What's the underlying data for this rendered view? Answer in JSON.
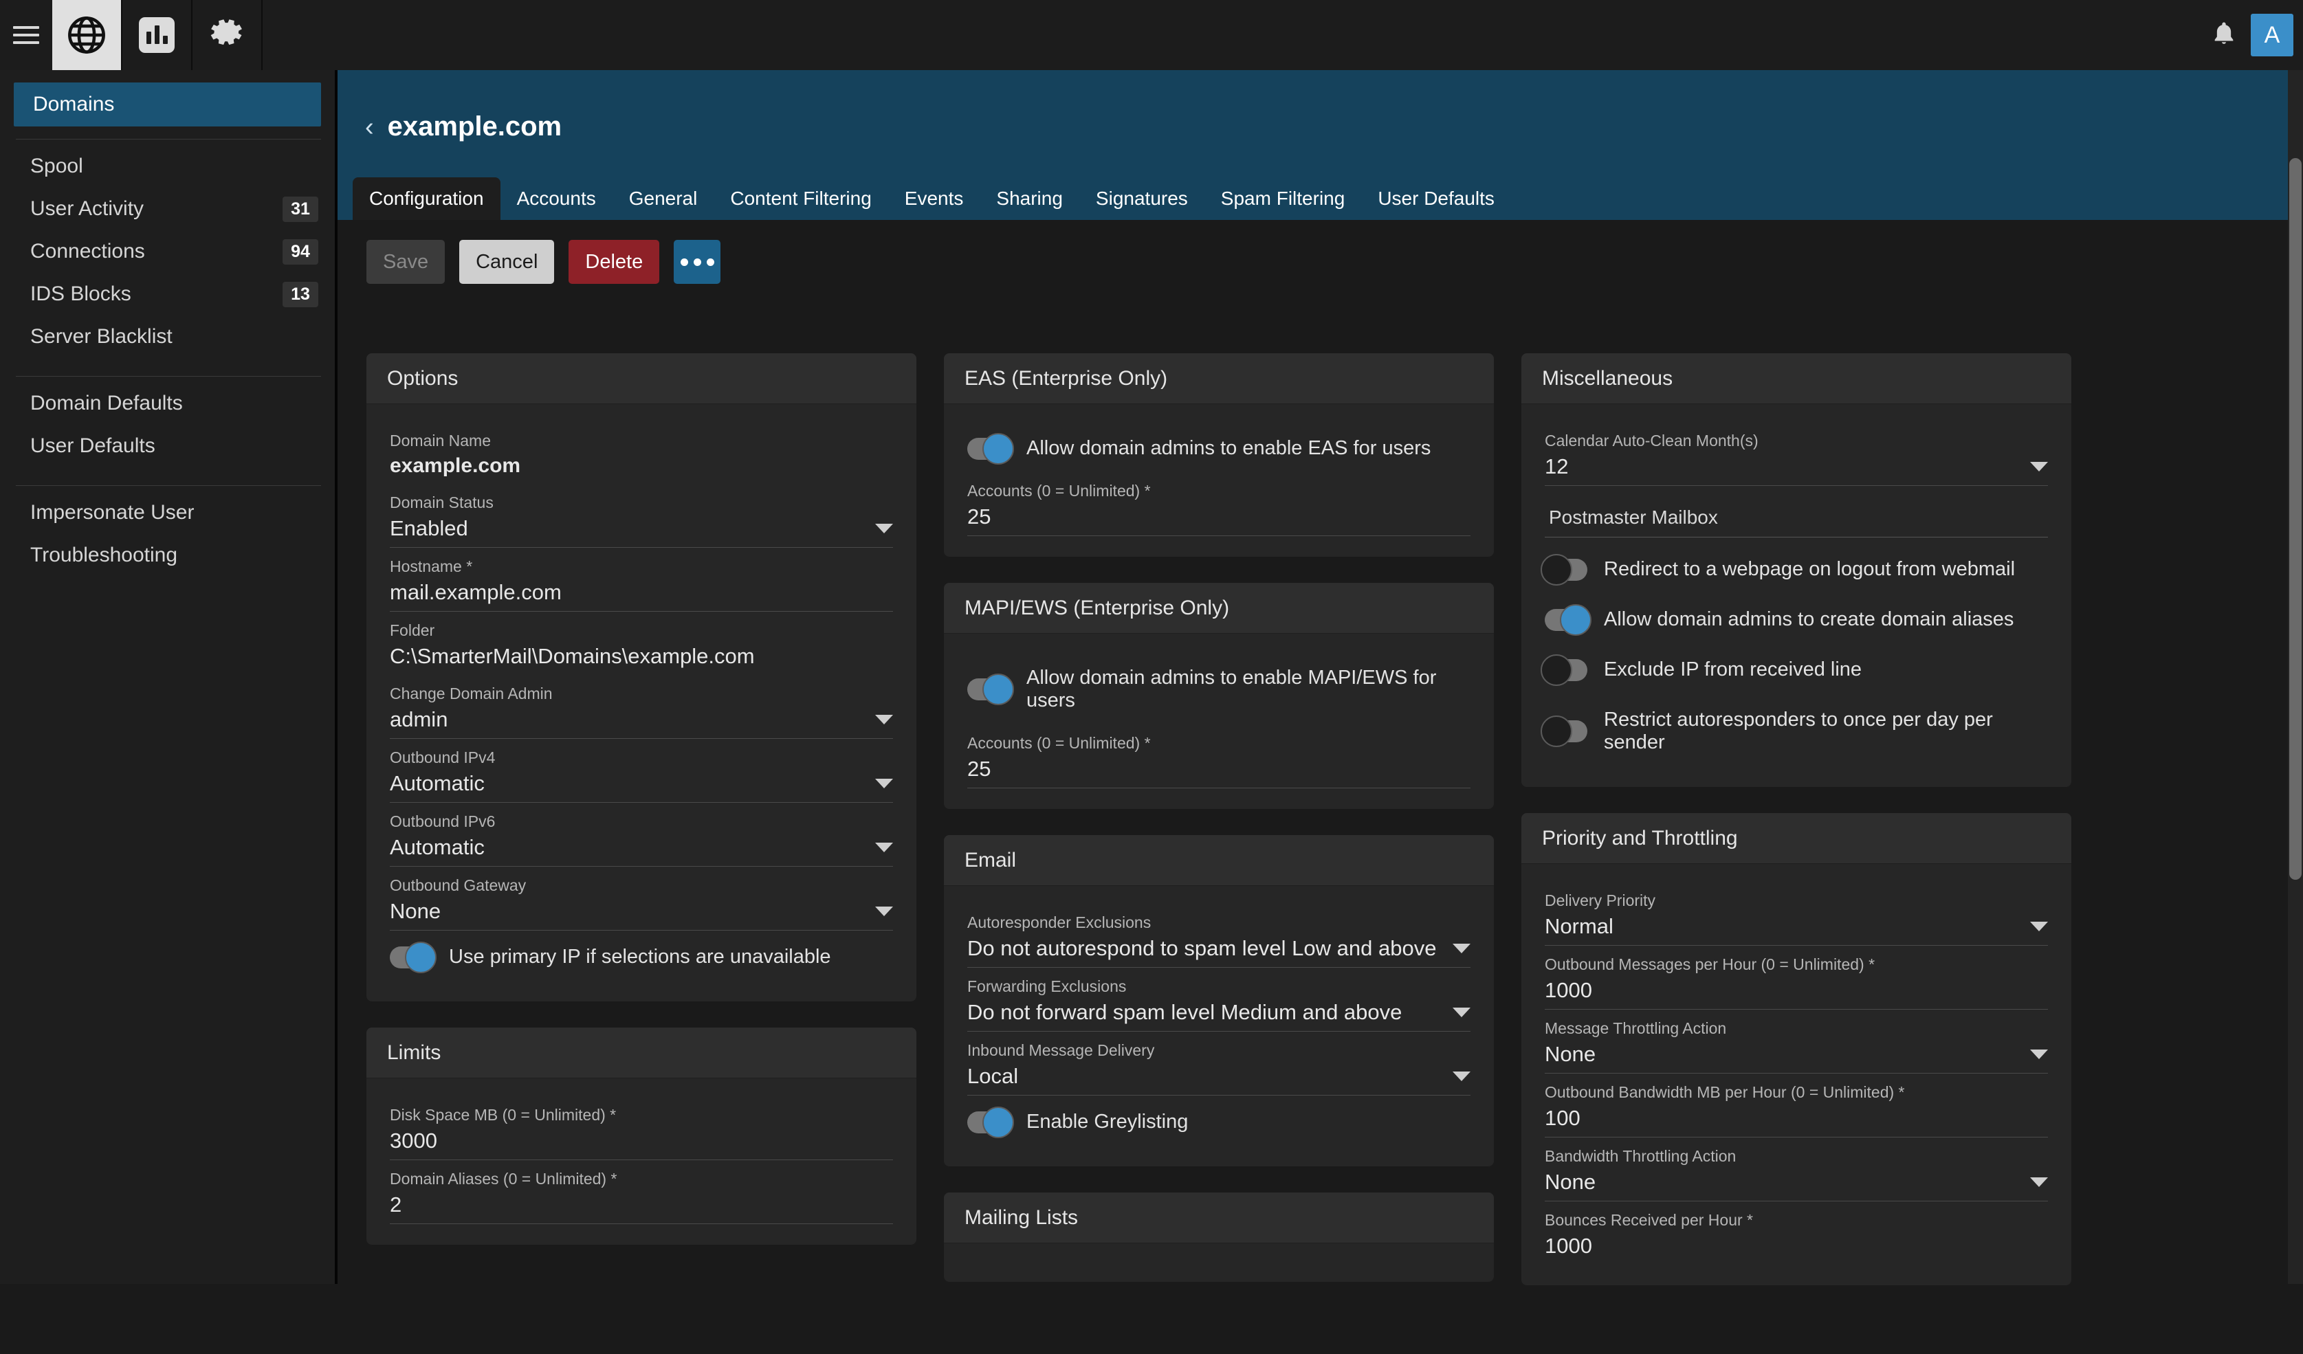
{
  "topbar": {
    "menu_icon": "hamburger-icon",
    "nav": [
      {
        "icon": "globe-icon",
        "active": true
      },
      {
        "icon": "bar-chart-icon",
        "active": false
      },
      {
        "icon": "gear-icon",
        "active": false
      }
    ],
    "bell_icon": "bell-icon",
    "avatar_initial": "A"
  },
  "sidebar": {
    "active_item": "Domains",
    "groups": [
      {
        "items": [
          {
            "label": "Spool",
            "badge": ""
          },
          {
            "label": "User Activity",
            "badge": "31"
          },
          {
            "label": "Connections",
            "badge": "94"
          },
          {
            "label": "IDS Blocks",
            "badge": "13"
          },
          {
            "label": "Server Blacklist",
            "badge": ""
          }
        ]
      },
      {
        "items": [
          {
            "label": "Domain Defaults",
            "badge": ""
          },
          {
            "label": "User Defaults",
            "badge": ""
          }
        ]
      },
      {
        "items": [
          {
            "label": "Impersonate User",
            "badge": ""
          },
          {
            "label": "Troubleshooting",
            "badge": ""
          }
        ]
      }
    ]
  },
  "header": {
    "back_chevron": "‹",
    "title": "example.com"
  },
  "tabs": [
    {
      "label": "Configuration",
      "active": true
    },
    {
      "label": "Accounts",
      "active": false
    },
    {
      "label": "General",
      "active": false
    },
    {
      "label": "Content Filtering",
      "active": false
    },
    {
      "label": "Events",
      "active": false
    },
    {
      "label": "Sharing",
      "active": false
    },
    {
      "label": "Signatures",
      "active": false
    },
    {
      "label": "Spam Filtering",
      "active": false
    },
    {
      "label": "User Defaults",
      "active": false
    }
  ],
  "toolbar": {
    "save_label": "Save",
    "cancel_label": "Cancel",
    "delete_label": "Delete",
    "more_label": ""
  },
  "options": {
    "title": "Options",
    "domain_name_label": "Domain Name",
    "domain_name_value": "example.com",
    "domain_status_label": "Domain Status",
    "domain_status_value": "Enabled",
    "hostname_label": "Hostname *",
    "hostname_value": "mail.example.com",
    "folder_label": "Folder",
    "folder_value": "C:\\SmarterMail\\Domains\\example.com",
    "change_admin_label": "Change Domain Admin",
    "change_admin_value": "admin",
    "ipv4_label": "Outbound IPv4",
    "ipv4_value": "Automatic",
    "ipv6_label": "Outbound IPv6",
    "ipv6_value": "Automatic",
    "gateway_label": "Outbound Gateway",
    "gateway_value": "None",
    "primary_ip_toggle_label": "Use primary IP if selections are unavailable"
  },
  "limits": {
    "title": "Limits",
    "disk_space_label": "Disk Space MB (0 = Unlimited) *",
    "disk_space_value": "3000",
    "domain_aliases_label": "Domain Aliases (0 = Unlimited) *",
    "domain_aliases_value": "2"
  },
  "eas": {
    "title": "EAS (Enterprise Only)",
    "toggle_label": "Allow domain admins to enable EAS for users",
    "accounts_label": "Accounts (0 = Unlimited) *",
    "accounts_value": "25"
  },
  "mapi": {
    "title": "MAPI/EWS (Enterprise Only)",
    "toggle_label": "Allow domain admins to enable MAPI/EWS for users",
    "accounts_label": "Accounts (0 = Unlimited) *",
    "accounts_value": "25"
  },
  "email": {
    "title": "Email",
    "autoresponder_label": "Autoresponder Exclusions",
    "autoresponder_value": "Do not autorespond to spam level Low and above",
    "forwarding_label": "Forwarding Exclusions",
    "forwarding_value": "Do not forward spam level Medium and above",
    "inbound_label": "Inbound Message Delivery",
    "inbound_value": "Local",
    "greylisting_label": "Enable Greylisting"
  },
  "mailing_lists": {
    "title": "Mailing Lists"
  },
  "misc": {
    "title": "Miscellaneous",
    "calendar_label": "Calendar Auto-Clean Month(s)",
    "calendar_value": "12",
    "postmaster_subhead": "Postmaster Mailbox",
    "toggle_redirect": "Redirect to a webpage on logout from webmail",
    "toggle_aliases": "Allow domain admins to create domain aliases",
    "toggle_exclude_ip": "Exclude IP from received line",
    "toggle_restrict_auto": "Restrict autoresponders to once per day per sender"
  },
  "priority": {
    "title": "Priority and Throttling",
    "delivery_label": "Delivery Priority",
    "delivery_value": "Normal",
    "outbound_msg_label": "Outbound Messages per Hour (0 = Unlimited) *",
    "outbound_msg_value": "1000",
    "msg_throttle_label": "Message Throttling Action",
    "msg_throttle_value": "None",
    "outbound_bw_label": "Outbound Bandwidth MB per Hour (0 = Unlimited) *",
    "outbound_bw_value": "100",
    "bw_throttle_label": "Bandwidth Throttling Action",
    "bw_throttle_value": "None",
    "bounces_label": "Bounces Received per Hour *",
    "bounces_value": "1000"
  },
  "colors": {
    "accent_blue": "#3b8fc9",
    "header_blue": "#15425c",
    "sidebar_active": "#1a5374",
    "delete_red": "#8e2128",
    "more_blue": "#1c628c"
  }
}
